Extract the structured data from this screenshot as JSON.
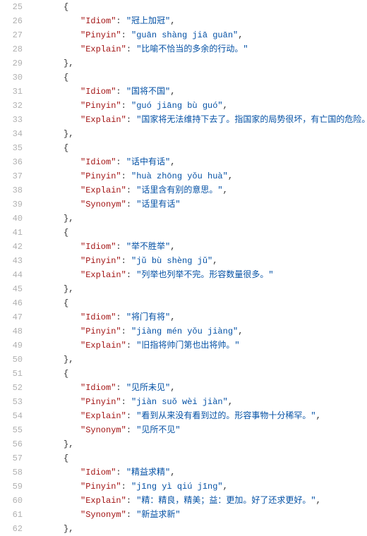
{
  "startLine": 25,
  "lines": [
    {
      "indent": 1,
      "type": "open"
    },
    {
      "indent": 2,
      "type": "kv",
      "key": "\"Idiom\"",
      "value": "\"冠上加冠\"",
      "comma": true
    },
    {
      "indent": 2,
      "type": "kv",
      "key": "\"Pinyin\"",
      "value": "\"guān shàng jiā guān\"",
      "comma": true
    },
    {
      "indent": 2,
      "type": "kv",
      "key": "\"Explain\"",
      "value": "\"比喻不恰当的多余的行动。\"",
      "comma": false
    },
    {
      "indent": 1,
      "type": "close",
      "comma": true
    },
    {
      "indent": 1,
      "type": "open"
    },
    {
      "indent": 2,
      "type": "kv",
      "key": "\"Idiom\"",
      "value": "\"国将不国\"",
      "comma": true
    },
    {
      "indent": 2,
      "type": "kv",
      "key": "\"Pinyin\"",
      "value": "\"guó jiāng bù guó\"",
      "comma": true
    },
    {
      "indent": 2,
      "type": "kv",
      "key": "\"Explain\"",
      "value": "\"国家将无法维持下去了。指国家的局势很坏，有亡国的危险。\"",
      "comma": false
    },
    {
      "indent": 1,
      "type": "close",
      "comma": true
    },
    {
      "indent": 1,
      "type": "open"
    },
    {
      "indent": 2,
      "type": "kv",
      "key": "\"Idiom\"",
      "value": "\"话中有话\"",
      "comma": true
    },
    {
      "indent": 2,
      "type": "kv",
      "key": "\"Pinyin\"",
      "value": "\"huà zhōng yǒu huà\"",
      "comma": true
    },
    {
      "indent": 2,
      "type": "kv",
      "key": "\"Explain\"",
      "value": "\"话里含有别的意思。\"",
      "comma": true
    },
    {
      "indent": 2,
      "type": "kv",
      "key": "\"Synonym\"",
      "value": "\"话里有话\"",
      "comma": false
    },
    {
      "indent": 1,
      "type": "close",
      "comma": true
    },
    {
      "indent": 1,
      "type": "open"
    },
    {
      "indent": 2,
      "type": "kv",
      "key": "\"Idiom\"",
      "value": "\"举不胜举\"",
      "comma": true
    },
    {
      "indent": 2,
      "type": "kv",
      "key": "\"Pinyin\"",
      "value": "\"jǔ bù shèng jǔ\"",
      "comma": true
    },
    {
      "indent": 2,
      "type": "kv",
      "key": "\"Explain\"",
      "value": "\"列举也列举不完。形容数量很多。\"",
      "comma": false
    },
    {
      "indent": 1,
      "type": "close",
      "comma": true
    },
    {
      "indent": 1,
      "type": "open"
    },
    {
      "indent": 2,
      "type": "kv",
      "key": "\"Idiom\"",
      "value": "\"将门有将\"",
      "comma": true
    },
    {
      "indent": 2,
      "type": "kv",
      "key": "\"Pinyin\"",
      "value": "\"jiàng mén yǒu jiàng\"",
      "comma": true
    },
    {
      "indent": 2,
      "type": "kv",
      "key": "\"Explain\"",
      "value": "\"旧指将帅门第也出将帅。\"",
      "comma": false
    },
    {
      "indent": 1,
      "type": "close",
      "comma": true
    },
    {
      "indent": 1,
      "type": "open"
    },
    {
      "indent": 2,
      "type": "kv",
      "key": "\"Idiom\"",
      "value": "\"见所未见\"",
      "comma": true
    },
    {
      "indent": 2,
      "type": "kv",
      "key": "\"Pinyin\"",
      "value": "\"jiàn suǒ wèi jiàn\"",
      "comma": true
    },
    {
      "indent": 2,
      "type": "kv",
      "key": "\"Explain\"",
      "value": "\"看到从来没有看到过的。形容事物十分稀罕。\"",
      "comma": true
    },
    {
      "indent": 2,
      "type": "kv",
      "key": "\"Synonym\"",
      "value": "\"见所不见\"",
      "comma": false
    },
    {
      "indent": 1,
      "type": "close",
      "comma": true
    },
    {
      "indent": 1,
      "type": "open"
    },
    {
      "indent": 2,
      "type": "kv",
      "key": "\"Idiom\"",
      "value": "\"精益求精\"",
      "comma": true
    },
    {
      "indent": 2,
      "type": "kv",
      "key": "\"Pinyin\"",
      "value": "\"jīng yì qiú jīng\"",
      "comma": true
    },
    {
      "indent": 2,
      "type": "kv",
      "key": "\"Explain\"",
      "value": "\"精：精良，精美；益：更加。好了还求更好。\"",
      "comma": true
    },
    {
      "indent": 2,
      "type": "kv",
      "key": "\"Synonym\"",
      "value": "\"新益求新\"",
      "comma": false
    },
    {
      "indent": 1,
      "type": "close",
      "comma": true
    }
  ]
}
